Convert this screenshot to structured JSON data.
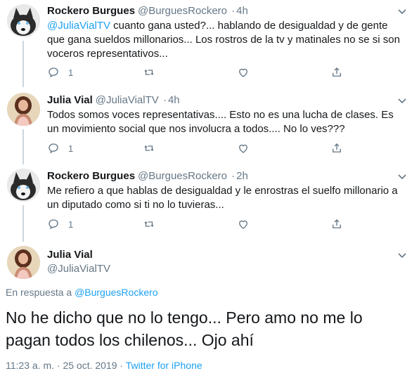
{
  "tweets": [
    {
      "name": "Rockero Burgues",
      "handle": "@BurguesRockero",
      "sep": "·",
      "time": "4h",
      "mention": "@JuliaVialTV",
      "text": " cuanto gana usted?... hablando de desigualdad y de gente que gana sueldos millonarios... Los rostros de la tv y matinales no se si son voceros representativos...",
      "reply_count": "1",
      "avatar": "husky-avatar"
    },
    {
      "name": "Julia Vial",
      "handle": "@JuliaVialTV",
      "sep": "·",
      "time": "4h",
      "mention": "",
      "text": "Todos somos voces representativas.... Esto no es una lucha de clases. Es un movimiento social que nos involucra a todos.... No lo ves???",
      "reply_count": "1",
      "avatar": "woman-avatar"
    },
    {
      "name": "Rockero Burgues",
      "handle": "@BurguesRockero",
      "sep": "·",
      "time": "2h",
      "mention": "",
      "text": "Me refiero a que hablas de desigualdad y le enrostras el suelfo millonario a un diputado como si ti no lo tuvieras...",
      "reply_count": "1",
      "avatar": "husky-avatar"
    }
  ],
  "main": {
    "name": "Julia Vial",
    "handle": "@JuliaVialTV",
    "reply_prefix": "En respuesta a ",
    "reply_handle": "@BurguesRockero",
    "text": "No he dicho que no lo tengo... Pero amo no me lo pagan todos los chilenos... Ojo ahí",
    "timestamp": "11:23 a. m. · 25 oct. 2019 · ",
    "source": "Twitter for iPhone"
  },
  "colors": {
    "accent": "#1da1f2",
    "secondary_text": "#657786",
    "divider": "#e6ecf0",
    "thread_line": "#ccd6dd"
  }
}
